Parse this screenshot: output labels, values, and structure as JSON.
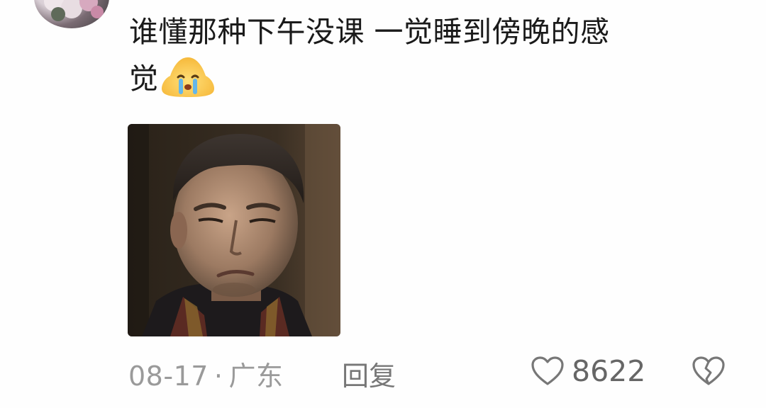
{
  "comment": {
    "line1": "谁懂那种下午没课 一觉睡到傍晚的感",
    "line2": "觉",
    "emoji": "loudly-crying-emoji"
  },
  "footer": {
    "date": "08-17",
    "separator": "·",
    "location": "广东",
    "reply_label": "回复",
    "like_count": "8622"
  },
  "icons": {
    "like": "heart-outline-icon",
    "dislike": "broken-heart-icon"
  },
  "colors": {
    "text": "#1a1a1a",
    "muted": "#9a9a9a",
    "background": "#fefefe"
  }
}
